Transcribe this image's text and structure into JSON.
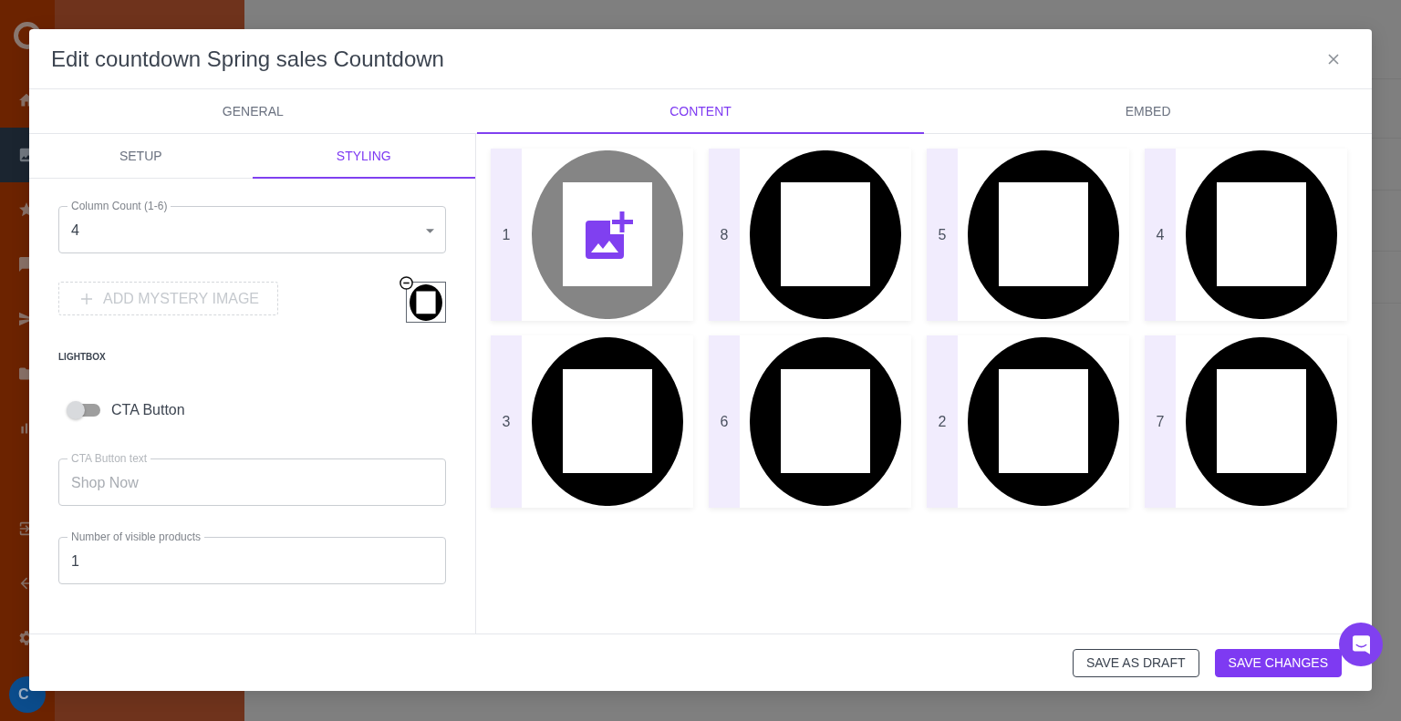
{
  "app": {
    "avatar": "C"
  },
  "nav": {
    "top": [
      {
        "selected": false
      },
      {
        "selected": true
      },
      {
        "selected": false
      },
      {
        "selected": false
      },
      {
        "selected": false
      },
      {
        "selected": false
      },
      {
        "selected": false
      }
    ],
    "bottom": [
      {
        "selected": false
      },
      {
        "selected": false
      },
      {
        "selected": false
      }
    ]
  },
  "modal": {
    "title": "Edit countdown Spring sales Countdown"
  },
  "tabs": [
    {
      "label": "GENERAL",
      "selected": false
    },
    {
      "label": "CONTENT",
      "selected": true
    },
    {
      "label": "EMBED",
      "selected": false
    }
  ],
  "subtabs": [
    {
      "label": "SETUP",
      "selected": false
    },
    {
      "label": "STYLING",
      "selected": true
    }
  ],
  "styling": {
    "column_count": {
      "label": "Column Count (1-6)",
      "value": "4"
    },
    "add_mystery_image": {
      "label": "ADD MYSTERY IMAGE",
      "disabled": true
    },
    "section_heading": "LIGHTBOX",
    "cta_toggle": {
      "label": "CTA Button",
      "on": false
    },
    "cta_text": {
      "label": "CTA Button text",
      "value": "Shop Now",
      "disabled": true
    },
    "visible_products": {
      "label": "Number of visible products",
      "value": "1"
    }
  },
  "content": {
    "cards": [
      {
        "number": "1",
        "kind": "upload"
      },
      {
        "number": "8",
        "kind": "image"
      },
      {
        "number": "5",
        "kind": "image"
      },
      {
        "number": "4",
        "kind": "image"
      },
      {
        "number": "3",
        "kind": "image"
      },
      {
        "number": "6",
        "kind": "image"
      },
      {
        "number": "2",
        "kind": "image"
      },
      {
        "number": "7",
        "kind": "image"
      }
    ]
  },
  "footer": {
    "buttons": [
      {
        "label": "SAVE AS DRAFT",
        "kind": "outlined"
      },
      {
        "label": "SAVE CHANGES",
        "kind": "primary"
      }
    ]
  }
}
